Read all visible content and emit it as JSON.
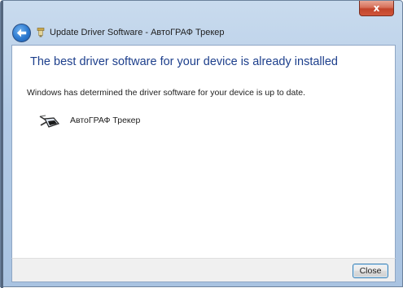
{
  "window": {
    "title": "Update Driver Software - АвтоГРАФ Трекер",
    "close_glyph": "x"
  },
  "main": {
    "headline": "The best driver software for your device is already installed",
    "description": "Windows has determined the driver software for your device is up to date.",
    "device_name": "АвтоГРАФ Трекер",
    "device_icon": "device-icon"
  },
  "footer": {
    "close_label": "Close"
  },
  "colors": {
    "headline": "#1d3f8c",
    "frame": "#b3cbe6",
    "close_button": "#c2442b"
  }
}
